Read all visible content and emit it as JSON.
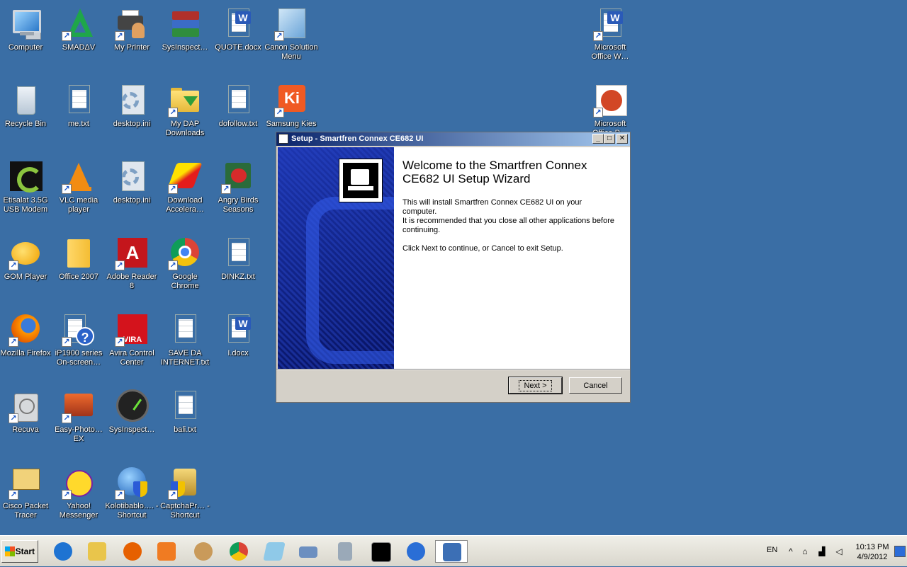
{
  "desktop": {
    "icons": [
      {
        "label": "Computer"
      },
      {
        "label": "SMADΔV"
      },
      {
        "label": "My Printer"
      },
      {
        "label": "SysInspect…"
      },
      {
        "label": "QUOTE.docx"
      },
      {
        "label": "Canon Solution Menu"
      },
      {
        "label": "Microsoft Office W…"
      },
      {
        "label": "Recycle Bin"
      },
      {
        "label": "me.txt"
      },
      {
        "label": "desktop.ini"
      },
      {
        "label": "My DAP Downloads"
      },
      {
        "label": "dofollow.txt"
      },
      {
        "label": "Samsung Kies"
      },
      {
        "label": "Microsoft Office P…"
      },
      {
        "label": "Etisalat 3.5G USB Modem"
      },
      {
        "label": "VLC media player"
      },
      {
        "label": "desktop.ini"
      },
      {
        "label": "Download Accelera…"
      },
      {
        "label": "Angry Birds Seasons"
      },
      {
        "label": "GOM Player"
      },
      {
        "label": "Office 2007"
      },
      {
        "label": "Adobe Reader 8"
      },
      {
        "label": "Google Chrome"
      },
      {
        "label": "DINKZ.txt"
      },
      {
        "label": "Mozilla Firefox"
      },
      {
        "label": "iP1900 series On-screen…"
      },
      {
        "label": "Avira Control Center"
      },
      {
        "label": "SAVE DA INTERNET.txt"
      },
      {
        "label": "I.docx"
      },
      {
        "label": "Recuva"
      },
      {
        "label": "Easy-Photo… EX"
      },
      {
        "label": "SysInspect…"
      },
      {
        "label": "bali.txt"
      },
      {
        "label": "Cisco Packet Tracer"
      },
      {
        "label": "Yahoo! Messenger"
      },
      {
        "label": "Kolotibablo…. - Shortcut"
      },
      {
        "label": "CaptchaPr… - Shortcut"
      }
    ]
  },
  "dialog": {
    "title": "Setup - Smartfren Connex CE682 UI",
    "heading": "Welcome to the Smartfren Connex CE682 UI Setup Wizard",
    "para1": "This will install Smartfren Connex CE682 UI on your computer.",
    "para2": "It is recommended that you close all other applications before continuing.",
    "para3": "Click Next to continue, or Cancel to exit Setup.",
    "next_label": "Next >",
    "cancel_label": "Cancel",
    "minimize_glyph": "_",
    "maximize_glyph": "□",
    "close_glyph": "✕"
  },
  "taskbar": {
    "start_label": "Start",
    "pinned": [
      "internet-explorer-icon",
      "explorer-folder-icon",
      "firefox-icon",
      "media-player-icon",
      "paint-icon",
      "chrome-icon",
      "notepad-icon",
      "keyboard-icon",
      "calculator-icon",
      "cmd-icon",
      "update-icon",
      "setup-icon"
    ],
    "accent_colors": {
      "ie": "#1e73d2",
      "folder": "#e9c54b",
      "firefox": "#e66000",
      "media": "#f07b22",
      "paint": "#c99a5a",
      "chrome": "#db4437",
      "notepad": "#8fc9e8",
      "keyboard": "#6c8fc0",
      "calculator": "#9aa9b8",
      "cmd": "#000000",
      "update": "#2a6ed6",
      "setup": "#3c6fb5"
    }
  },
  "tray": {
    "language": "EN",
    "time": "10:13 PM",
    "date": "4/9/2012"
  }
}
